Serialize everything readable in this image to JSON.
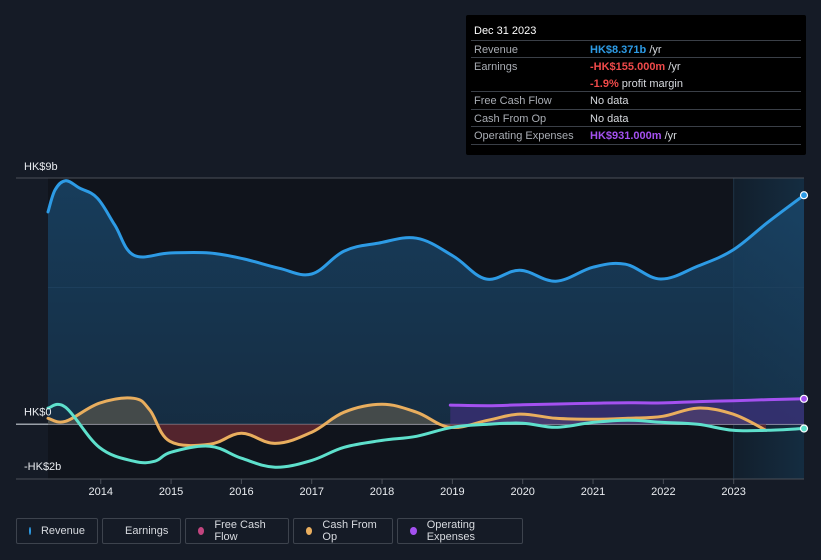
{
  "tooltip": {
    "date": "Dec 31 2023",
    "rows": [
      {
        "label": "Revenue",
        "value": "HK$8.371b",
        "unit": " /yr"
      },
      {
        "label": "Earnings",
        "value": "-HK$155.000m",
        "unit": " /yr",
        "sub_value": "-1.9%",
        "sub_text": " profit margin"
      },
      {
        "label": "Free Cash Flow",
        "value": "No data"
      },
      {
        "label": "Cash From Op",
        "value": "No data"
      },
      {
        "label": "Operating Expenses",
        "value": "HK$931.000m",
        "unit": " /yr"
      }
    ]
  },
  "legend": [
    {
      "label": "Revenue",
      "color": "#2d9be5"
    },
    {
      "label": "Earnings",
      "color": "#5ee0cc"
    },
    {
      "label": "Free Cash Flow",
      "color": "#c2457f"
    },
    {
      "label": "Cash From Op",
      "color": "#e9ae5e"
    },
    {
      "label": "Operating Expenses",
      "color": "#a451f0"
    }
  ],
  "chart_data": {
    "type": "line",
    "title": "",
    "xlabel": "",
    "ylabel": "",
    "y_unit": "HK$ billions",
    "ylim": [
      -2,
      9
    ],
    "xlim": [
      2013.25,
      2024.0
    ],
    "y_tick_labels": [
      {
        "value": 9,
        "label": "HK$9b"
      },
      {
        "value": 0,
        "label": "HK$0"
      },
      {
        "value": -2,
        "label": "-HK$2b"
      }
    ],
    "x_ticks": [
      2014,
      2015,
      2016,
      2017,
      2018,
      2019,
      2020,
      2021,
      2022,
      2023
    ],
    "x_tick_labels": [
      "2014",
      "2015",
      "2016",
      "2017",
      "2018",
      "2019",
      "2020",
      "2021",
      "2022",
      "2023"
    ],
    "highlight_from": 2023.0,
    "grid": true,
    "legend_position": "bottom",
    "series": [
      {
        "name": "Revenue",
        "color": "#2d9be5",
        "x": [
          2013.25,
          2013.35,
          2013.5,
          2013.7,
          2013.95,
          2014.2,
          2014.47,
          2014.98,
          2015.55,
          2016.04,
          2016.54,
          2017.0,
          2017.46,
          2017.95,
          2018.49,
          2019.01,
          2019.48,
          2019.96,
          2020.47,
          2021.0,
          2021.46,
          2021.96,
          2022.49,
          2022.99,
          2023.49,
          2024.0
        ],
        "values": [
          7.76,
          8.56,
          8.9,
          8.63,
          8.27,
          7.28,
          6.18,
          6.26,
          6.26,
          6.04,
          5.7,
          5.49,
          6.33,
          6.62,
          6.8,
          6.15,
          5.31,
          5.63,
          5.23,
          5.74,
          5.85,
          5.31,
          5.78,
          6.37,
          7.39,
          8.371
        ]
      },
      {
        "name": "Earnings",
        "color": "#5ee0cc",
        "x": [
          2013.25,
          2013.5,
          2013.98,
          2014.47,
          2014.77,
          2015.0,
          2015.55,
          2016.0,
          2016.48,
          2017.0,
          2017.46,
          2018.0,
          2018.49,
          2019.0,
          2019.51,
          2020.0,
          2020.47,
          2021.0,
          2021.5,
          2021.99,
          2022.49,
          2022.99,
          2023.49,
          2024.0
        ],
        "values": [
          0.59,
          0.62,
          -0.84,
          -1.35,
          -1.35,
          -1.02,
          -0.8,
          -1.24,
          -1.57,
          -1.32,
          -0.84,
          -0.59,
          -0.44,
          -0.11,
          0.0,
          0.04,
          -0.11,
          0.07,
          0.15,
          0.07,
          0.0,
          -0.22,
          -0.22,
          -0.155
        ]
      },
      {
        "name": "Free Cash Flow",
        "color": "#c2457f",
        "x": [],
        "values": []
      },
      {
        "name": "Cash From Op",
        "color": "#e9ae5e",
        "x": [
          2013.25,
          2013.5,
          2013.98,
          2014.47,
          2014.7,
          2014.98,
          2015.55,
          2016.0,
          2016.48,
          2017.0,
          2017.46,
          2018.0,
          2018.49,
          2018.97,
          2019.51,
          2019.96,
          2020.47,
          2021.0,
          2021.5,
          2021.99,
          2022.49,
          2022.99,
          2023.46
        ],
        "values": [
          0.22,
          0.11,
          0.77,
          0.95,
          0.51,
          -0.62,
          -0.73,
          -0.33,
          -0.7,
          -0.29,
          0.44,
          0.73,
          0.44,
          -0.11,
          0.15,
          0.37,
          0.22,
          0.18,
          0.22,
          0.29,
          0.59,
          0.37,
          -0.22
        ]
      },
      {
        "name": "Operating Expenses",
        "color": "#a451f0",
        "x": [
          2018.97,
          2019.5,
          2020.0,
          2020.5,
          2021.0,
          2021.5,
          2022.0,
          2022.5,
          2023.0,
          2023.5,
          2024.0
        ],
        "values": [
          0.7,
          0.68,
          0.71,
          0.74,
          0.77,
          0.79,
          0.78,
          0.83,
          0.86,
          0.9,
          0.931
        ]
      }
    ]
  }
}
